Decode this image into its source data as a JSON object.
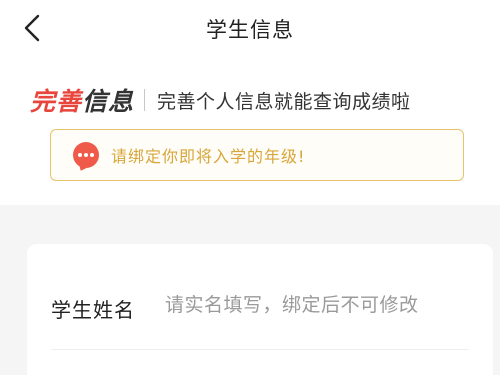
{
  "nav": {
    "title": "学生信息",
    "back_icon": "chevron-left-icon"
  },
  "header": {
    "brand_part1": "完善",
    "brand_part2": "信息",
    "subtitle": "完善个人信息就能查询成绩啦"
  },
  "notice": {
    "icon": "chat-bubble-icon",
    "text": "请绑定你即将入学的年级!"
  },
  "form": {
    "fields": [
      {
        "label": "学生姓名",
        "value": "",
        "placeholder": "请实名填写，绑定后不可修改"
      }
    ]
  },
  "colors": {
    "accent_red": "#e8453c",
    "notice_border": "#e6c26a",
    "notice_text": "#d8a53a",
    "background_gray": "#f5f5f5"
  }
}
